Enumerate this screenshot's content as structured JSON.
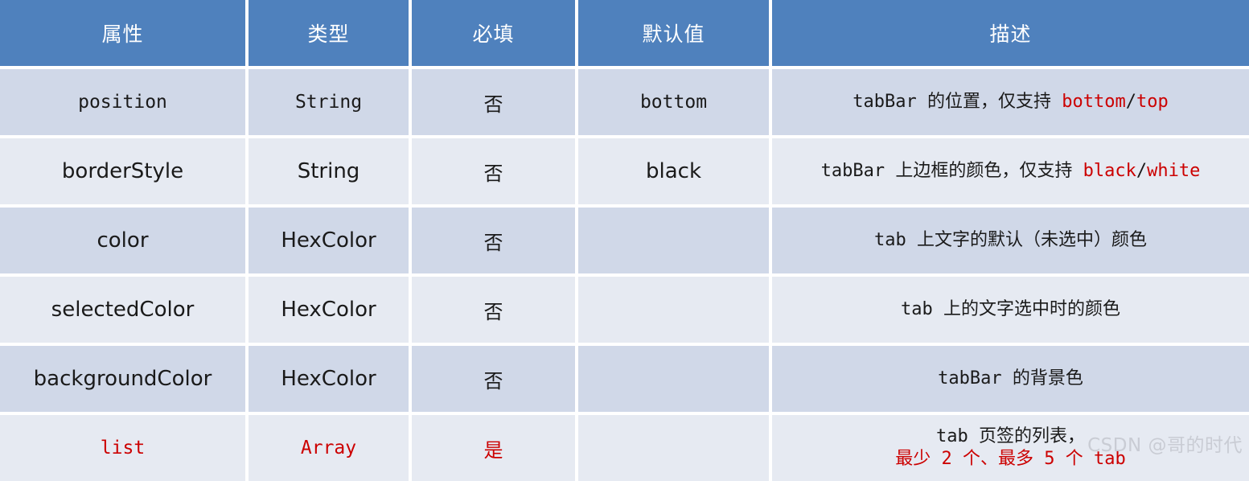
{
  "table": {
    "headers": [
      {
        "label": "属性"
      },
      {
        "label": "类型"
      },
      {
        "label": "必填"
      },
      {
        "label": "默认值"
      },
      {
        "label": "描述"
      }
    ],
    "rows": [
      {
        "attribute": "position",
        "type": "String",
        "required": "否",
        "default": "bottom",
        "description_prefix": "tabBar 的位置，仅支持 ",
        "description_red_a": "bottom",
        "description_sep": "/",
        "description_red_b": "top"
      },
      {
        "attribute": "borderStyle",
        "type": "String",
        "required": "否",
        "default": "black",
        "description_prefix": "tabBar 上边框的颜色，仅支持 ",
        "description_red_a": "black",
        "description_sep": "/",
        "description_red_b": "white"
      },
      {
        "attribute": "color",
        "type": "HexColor",
        "required": "否",
        "default": "",
        "description_prefix": "tab 上文字的默认（未选中）颜色",
        "description_red_a": "",
        "description_sep": "",
        "description_red_b": ""
      },
      {
        "attribute": "selectedColor",
        "type": "HexColor",
        "required": "否",
        "default": "",
        "description_prefix": "tab 上的文字选中时的颜色",
        "description_red_a": "",
        "description_sep": "",
        "description_red_b": ""
      },
      {
        "attribute": "backgroundColor",
        "type": "HexColor",
        "required": "否",
        "default": "",
        "description_prefix": "tabBar 的背景色",
        "description_red_a": "",
        "description_sep": "",
        "description_red_b": ""
      },
      {
        "attribute": "list",
        "type": "Array",
        "required": "是",
        "default": "",
        "description_line1": "tab 页签的列表，",
        "description_line2": "最少 2 个、最多 5 个 tab"
      }
    ]
  },
  "watermark": {
    "text": "CSDN @哥的时代"
  },
  "colors": {
    "header_bg": "#4f81bd",
    "header_text": "#ffffff",
    "row_dark": "#d0d8e8",
    "row_light": "#e6eaf2",
    "accent_red": "#cc0000",
    "body_text": "#1a1a1a",
    "watermark": "#c9ccd4"
  }
}
